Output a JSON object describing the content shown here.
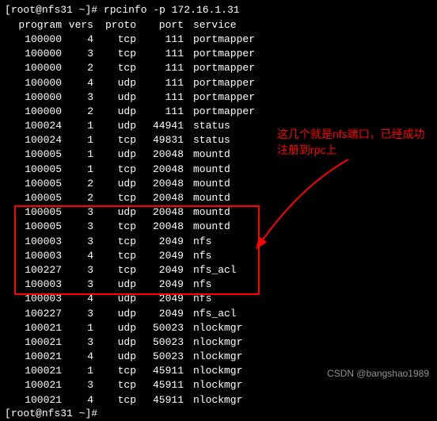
{
  "prompt": {
    "user": "root",
    "host": "nfs31",
    "cwd": "~",
    "symbol": "#",
    "command": "rpcinfo -p 172.16.1.31"
  },
  "headers": {
    "program": "program",
    "vers": "vers",
    "proto": "proto",
    "port": "port",
    "service": "service"
  },
  "rows": [
    {
      "program": "100000",
      "vers": "4",
      "proto": "tcp",
      "port": "111",
      "service": "portmapper"
    },
    {
      "program": "100000",
      "vers": "3",
      "proto": "tcp",
      "port": "111",
      "service": "portmapper"
    },
    {
      "program": "100000",
      "vers": "2",
      "proto": "tcp",
      "port": "111",
      "service": "portmapper"
    },
    {
      "program": "100000",
      "vers": "4",
      "proto": "udp",
      "port": "111",
      "service": "portmapper"
    },
    {
      "program": "100000",
      "vers": "3",
      "proto": "udp",
      "port": "111",
      "service": "portmapper"
    },
    {
      "program": "100000",
      "vers": "2",
      "proto": "udp",
      "port": "111",
      "service": "portmapper"
    },
    {
      "program": "100024",
      "vers": "1",
      "proto": "udp",
      "port": "44941",
      "service": "status"
    },
    {
      "program": "100024",
      "vers": "1",
      "proto": "tcp",
      "port": "49831",
      "service": "status"
    },
    {
      "program": "100005",
      "vers": "1",
      "proto": "udp",
      "port": "20048",
      "service": "mountd"
    },
    {
      "program": "100005",
      "vers": "1",
      "proto": "tcp",
      "port": "20048",
      "service": "mountd"
    },
    {
      "program": "100005",
      "vers": "2",
      "proto": "udp",
      "port": "20048",
      "service": "mountd"
    },
    {
      "program": "100005",
      "vers": "2",
      "proto": "tcp",
      "port": "20048",
      "service": "mountd"
    },
    {
      "program": "100005",
      "vers": "3",
      "proto": "udp",
      "port": "20048",
      "service": "mountd"
    },
    {
      "program": "100005",
      "vers": "3",
      "proto": "tcp",
      "port": "20048",
      "service": "mountd"
    },
    {
      "program": "100003",
      "vers": "3",
      "proto": "tcp",
      "port": "2049",
      "service": "nfs"
    },
    {
      "program": "100003",
      "vers": "4",
      "proto": "tcp",
      "port": "2049",
      "service": "nfs"
    },
    {
      "program": "100227",
      "vers": "3",
      "proto": "tcp",
      "port": "2049",
      "service": "nfs_acl"
    },
    {
      "program": "100003",
      "vers": "3",
      "proto": "udp",
      "port": "2049",
      "service": "nfs"
    },
    {
      "program": "100003",
      "vers": "4",
      "proto": "udp",
      "port": "2049",
      "service": "nfs"
    },
    {
      "program": "100227",
      "vers": "3",
      "proto": "udp",
      "port": "2049",
      "service": "nfs_acl"
    },
    {
      "program": "100021",
      "vers": "1",
      "proto": "udp",
      "port": "50023",
      "service": "nlockmgr"
    },
    {
      "program": "100021",
      "vers": "3",
      "proto": "udp",
      "port": "50023",
      "service": "nlockmgr"
    },
    {
      "program": "100021",
      "vers": "4",
      "proto": "udp",
      "port": "50023",
      "service": "nlockmgr"
    },
    {
      "program": "100021",
      "vers": "1",
      "proto": "tcp",
      "port": "45911",
      "service": "nlockmgr"
    },
    {
      "program": "100021",
      "vers": "3",
      "proto": "tcp",
      "port": "45911",
      "service": "nlockmgr"
    },
    {
      "program": "100021",
      "vers": "4",
      "proto": "tcp",
      "port": "45911",
      "service": "nlockmgr"
    }
  ],
  "annotation": "这几个就是nfs端口，已经成功注册到rpc上",
  "watermark": "CSDN @bangshao1989",
  "prompt2": {
    "user": "root",
    "host": "nfs31",
    "cwd": "~",
    "symbol": "#"
  }
}
